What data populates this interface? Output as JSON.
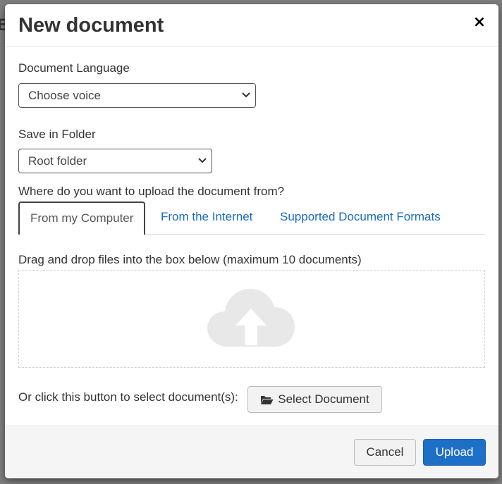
{
  "backdrop": {
    "partial_char": "B"
  },
  "modal": {
    "title": "New document",
    "close_label": "×"
  },
  "form": {
    "language_label": "Document Language",
    "language_value": "Choose voice",
    "folder_label": "Save in Folder",
    "folder_value": "Root folder",
    "upload_source_label": "Where do you want to upload the document from?"
  },
  "tabs": [
    {
      "label": "From my Computer",
      "active": true
    },
    {
      "label": "From the Internet",
      "active": false
    },
    {
      "label": "Supported Document Formats",
      "active": false
    }
  ],
  "upload": {
    "dropzone_label": "Drag and drop files into the box below (maximum 10 documents)",
    "select_prompt": "Or click this button to select document(s):",
    "select_button_label": "Select Document"
  },
  "footer": {
    "cancel_label": "Cancel",
    "upload_label": "Upload"
  },
  "colors": {
    "primary": "#1e6fc8",
    "link": "#1a6bbf",
    "cloud": "#e8e8e8"
  }
}
